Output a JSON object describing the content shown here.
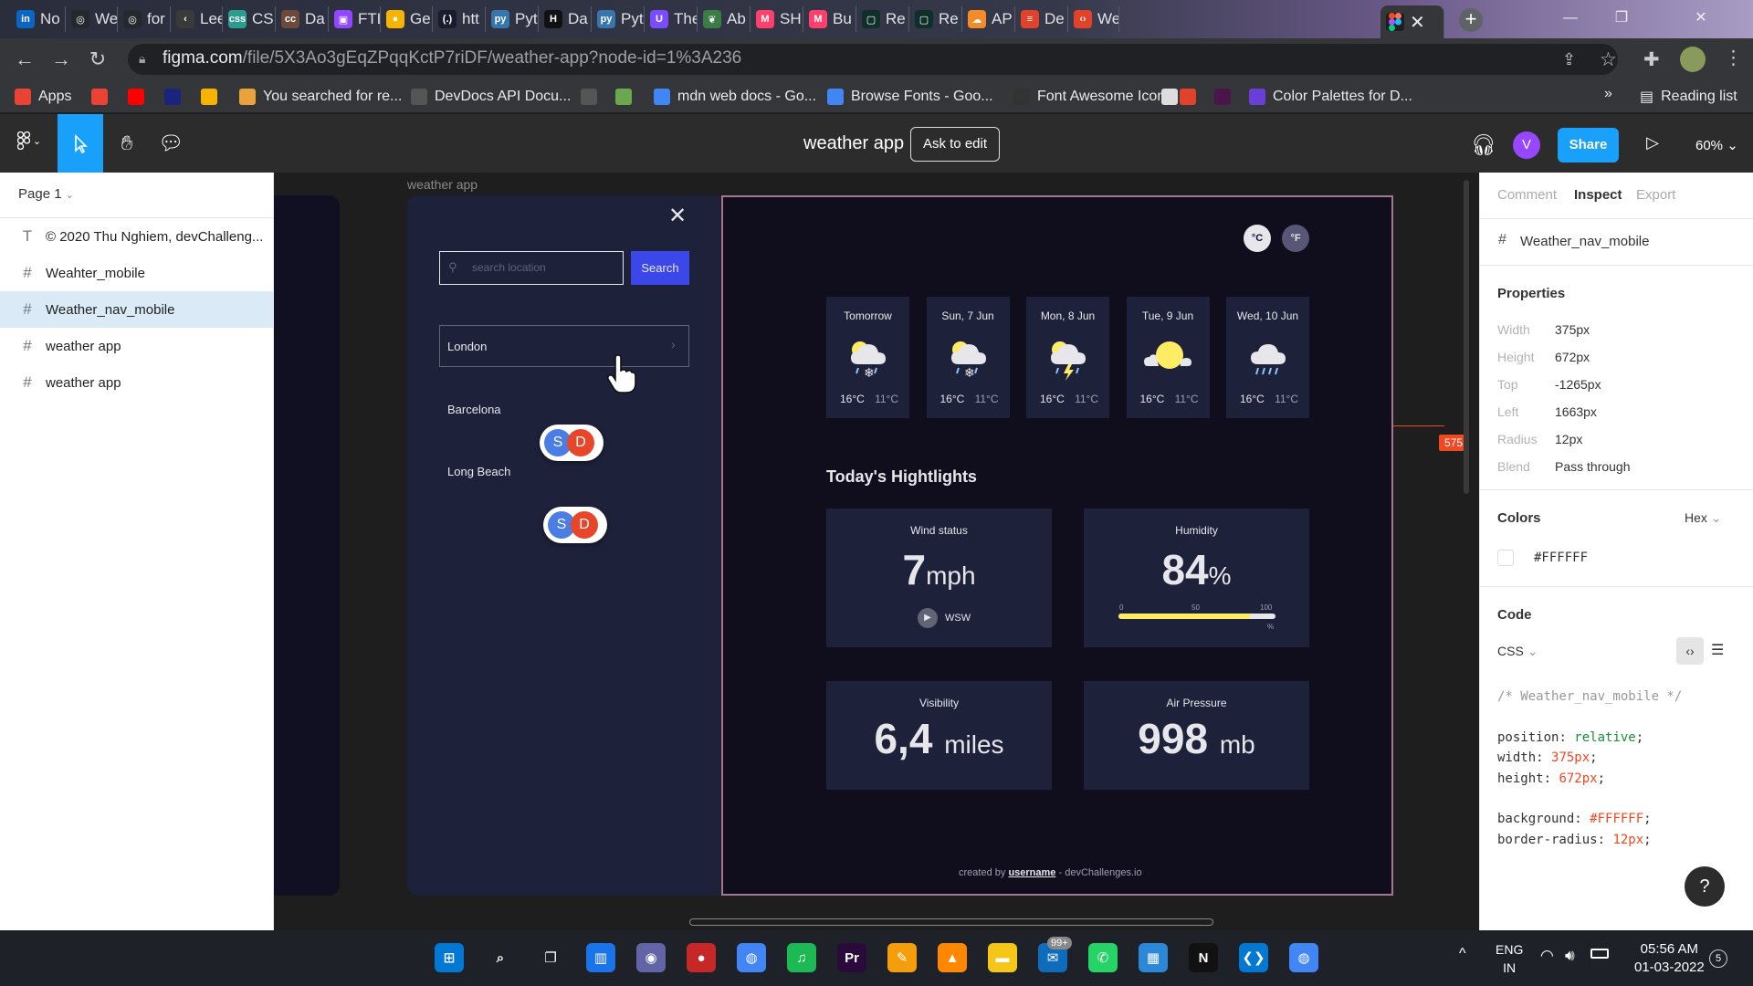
{
  "browser": {
    "tabs": [
      {
        "label": "No",
        "icon": "linkedin-icon",
        "color": "#0a66c2",
        "glyph": "in"
      },
      {
        "label": "We",
        "icon": "github-icon",
        "color": "#24292e",
        "glyph": "◎"
      },
      {
        "label": "for",
        "icon": "github-icon",
        "color": "#24292e",
        "glyph": "◎"
      },
      {
        "label": "Lee",
        "icon": "leetcode-icon",
        "color": "#3a3a3a",
        "glyph": "‹"
      },
      {
        "label": "CS",
        "icon": "css-icon",
        "color": "#2a9d8f",
        "glyph": "css"
      },
      {
        "label": "Da",
        "icon": "codecademy-icon",
        "color": "#6b4a3a",
        "glyph": "cc"
      },
      {
        "label": "FTL",
        "icon": "twitch-icon",
        "color": "#9146ff",
        "glyph": "▣"
      },
      {
        "label": "Ge",
        "icon": "keep-icon",
        "color": "#f6b400",
        "glyph": "●"
      },
      {
        "label": "htt",
        "icon": "regex-icon",
        "color": "#1a1a2e",
        "glyph": "(.)"
      },
      {
        "label": "Pyt",
        "icon": "python-icon",
        "color": "#3776ab",
        "glyph": "py"
      },
      {
        "label": "Da",
        "icon": "hackerrank-icon",
        "color": "#111",
        "glyph": "H"
      },
      {
        "label": "Pyt",
        "icon": "python-icon",
        "color": "#3776ab",
        "glyph": "py"
      },
      {
        "label": "The",
        "icon": "ublock-icon",
        "color": "#7a4cff",
        "glyph": "U"
      },
      {
        "label": "Ab",
        "icon": "leaf-icon",
        "color": "#3a7d44",
        "glyph": "❦"
      },
      {
        "label": "SH",
        "icon": "myntra-icon",
        "color": "#ff3f6c",
        "glyph": "M"
      },
      {
        "label": "Bu",
        "icon": "myntra-icon",
        "color": "#ff3f6c",
        "glyph": "M"
      },
      {
        "label": "Re",
        "icon": "square-icon",
        "color": "#0f2f2a",
        "glyph": "▢"
      },
      {
        "label": "Re",
        "icon": "square-icon",
        "color": "#0f2f2a",
        "glyph": "▢"
      },
      {
        "label": "AP",
        "icon": "cloud-icon",
        "color": "#f28c28",
        "glyph": "☁"
      },
      {
        "label": "De",
        "icon": "devdocs-icon",
        "color": "#e2422a",
        "glyph": "≡"
      },
      {
        "label": "We",
        "icon": "code-icon",
        "color": "#e2422a",
        "glyph": "‹›"
      }
    ],
    "active_tab_icon": "figma-icon",
    "url_host": "figma.com",
    "url_path": "/file/5X3Ao3gEqZPqqKctP7riDF/weather-app?node-id=1%3A236",
    "bookmarks": [
      {
        "label": "Apps",
        "icon": "apps-grid-icon",
        "color": "#ea4335"
      },
      {
        "label": "",
        "icon": "gmail-icon",
        "color": "#ea4335"
      },
      {
        "label": "",
        "icon": "youtube-icon",
        "color": "#ff0000"
      },
      {
        "label": "",
        "icon": "devhints-icon",
        "color": "#1a237e"
      },
      {
        "label": "",
        "icon": "keep-icon",
        "color": "#f6b400"
      },
      {
        "label": "You searched for re...",
        "icon": "sun-icon",
        "color": "#e8a33d"
      },
      {
        "label": "DevDocs API Docu...",
        "icon": "devdocs-icon",
        "color": "#555"
      },
      {
        "label": "",
        "icon": "speed-icon",
        "color": "#555"
      },
      {
        "label": "",
        "icon": "image-icon",
        "color": "#6aa84f"
      },
      {
        "label": "mdn web docs - Go...",
        "icon": "google-icon",
        "color": "#4285f4"
      },
      {
        "label": "Browse Fonts - Goo...",
        "icon": "fonts-icon",
        "color": "#4285f4"
      },
      {
        "label": "Font Awesome Icons",
        "icon": "flag-icon",
        "color": "#333"
      },
      {
        "label": "",
        "icon": "doc-icon",
        "color": "#ddd"
      },
      {
        "label": "",
        "icon": "code-icon",
        "color": "#e2422a"
      },
      {
        "label": "",
        "icon": "slack-icon",
        "color": "#4a154b"
      },
      {
        "label": "Color Palettes for D...",
        "icon": "palette-icon",
        "color": "#6a3fd6"
      }
    ],
    "reading_list": "Reading list",
    "more_bookmarks": "»"
  },
  "figma": {
    "file_title": "weather app",
    "ask_to_edit": "Ask to edit",
    "avatar_initial": "V",
    "share_label": "Share",
    "zoom_label": "60%",
    "page_label": "Page 1",
    "layers": [
      {
        "label": "© 2020 Thu Nghiem, devChalleng...",
        "icon": "text-icon",
        "glyph": "T",
        "selected": false
      },
      {
        "label": "Weahter_mobile",
        "icon": "frame-icon",
        "glyph": "#",
        "selected": false
      },
      {
        "label": "Weather_nav_mobile",
        "icon": "frame-icon",
        "glyph": "#",
        "selected": true
      },
      {
        "label": "weather app",
        "icon": "frame-icon",
        "glyph": "#",
        "selected": false
      },
      {
        "label": "weather app",
        "icon": "frame-icon",
        "glyph": "#",
        "selected": false
      }
    ],
    "canvas_frame_label": "weather app",
    "measure_badge": "575",
    "inspect": {
      "tabs": [
        "Comment",
        "Inspect",
        "Export"
      ],
      "active_tab": "Inspect",
      "selected_name": "Weather_nav_mobile",
      "properties_title": "Properties",
      "properties": [
        {
          "label": "Width",
          "value": "375px"
        },
        {
          "label": "Height",
          "value": "672px"
        },
        {
          "label": "Top",
          "value": "-1265px"
        },
        {
          "label": "Left",
          "value": "1663px"
        },
        {
          "label": "Radius",
          "value": "12px"
        },
        {
          "label": "Blend",
          "value": "Pass through"
        }
      ],
      "colors_title": "Colors",
      "color_format": "Hex",
      "color_value": "#FFFFFF",
      "code_title": "Code",
      "code_lang": "CSS",
      "css_comment": "/* Weather_nav_mobile */",
      "css_lines": [
        {
          "prop": "position",
          "val": "relative",
          "cls": "cg"
        },
        {
          "prop": "width",
          "val": "375px",
          "cls": "co"
        },
        {
          "prop": "height",
          "val": "672px",
          "cls": "co"
        },
        {
          "prop": "background",
          "val": "#FFFFFF",
          "cls": "co"
        },
        {
          "prop": "border-radius",
          "val": "12px",
          "cls": "co"
        }
      ],
      "help": "?"
    }
  },
  "weather_nav": {
    "search_placeholder": "search location",
    "search_button": "Search",
    "cities": [
      "London",
      "Barcelona",
      "Long Beach"
    ],
    "collab_initials": [
      "S",
      "D"
    ]
  },
  "weather_main": {
    "celsius": "°C",
    "fahrenheit": "°F",
    "forecast": [
      {
        "day": "Tomorrow",
        "icon": "sleet-icon",
        "max": "16°C",
        "min": "11°C"
      },
      {
        "day": "Sun, 7 Jun",
        "icon": "sleet-icon",
        "max": "16°C",
        "min": "11°C"
      },
      {
        "day": "Mon, 8 Jun",
        "icon": "thunderstorm-icon",
        "max": "16°C",
        "min": "11°C"
      },
      {
        "day": "Tue, 9 Jun",
        "icon": "sun-cloud-icon",
        "max": "16°C",
        "min": "11°C"
      },
      {
        "day": "Wed, 10 Jun",
        "icon": "rain-icon",
        "max": "16°C",
        "min": "11°C"
      }
    ],
    "highlights_title": "Today's Hightlights",
    "wind": {
      "title": "Wind status",
      "value": "7",
      "unit": "mph",
      "direction": "WSW"
    },
    "humidity": {
      "title": "Humidity",
      "value": "84",
      "unit": "%",
      "percent": 84,
      "ticks": [
        "0",
        "50",
        "100"
      ],
      "tick_unit": "%"
    },
    "visibility": {
      "title": "Visibility",
      "value": "6,4",
      "unit": "miles"
    },
    "pressure": {
      "title": "Air Pressure",
      "value": "998",
      "unit": "mb"
    },
    "footer_prefix": "created by",
    "footer_user": "username",
    "footer_suffix": "- devChallenges.io"
  },
  "taskbar": {
    "apps": [
      {
        "icon": "windows-start-icon",
        "color": "#0078d4",
        "glyph": "⊞"
      },
      {
        "icon": "search-icon",
        "color": "transparent",
        "glyph": "⌕"
      },
      {
        "icon": "task-view-icon",
        "color": "transparent",
        "glyph": "❐"
      },
      {
        "icon": "widgets-icon",
        "color": "#1a73e8",
        "glyph": "▥"
      },
      {
        "icon": "teams-chat-icon",
        "color": "#6264a7",
        "glyph": "◉"
      },
      {
        "icon": "record-icon",
        "color": "#c62828",
        "glyph": "●"
      },
      {
        "icon": "chrome-icon",
        "color": "#4285f4",
        "glyph": "◍"
      },
      {
        "icon": "spotify-icon",
        "color": "#1db954",
        "glyph": "♫"
      },
      {
        "icon": "premiere-icon",
        "color": "#2a0a3a",
        "glyph": "Pr"
      },
      {
        "icon": "paint-icon",
        "color": "#f59e0b",
        "glyph": "✎"
      },
      {
        "icon": "vlc-icon",
        "color": "#ff8800",
        "glyph": "▲"
      },
      {
        "icon": "file-explorer-icon",
        "color": "#f5c518",
        "glyph": "▬"
      },
      {
        "icon": "mail-icon",
        "color": "#0f6cbd",
        "glyph": "✉"
      },
      {
        "icon": "whatsapp-icon",
        "color": "#25d366",
        "glyph": "✆"
      },
      {
        "icon": "photos-icon",
        "color": "#2b88d8",
        "glyph": "▦"
      },
      {
        "icon": "netflix-icon",
        "color": "#111",
        "glyph": "N"
      },
      {
        "icon": "vscode-icon",
        "color": "#0078d4",
        "glyph": "❮❯"
      },
      {
        "icon": "chrome-icon",
        "color": "#4285f4",
        "glyph": "◍"
      }
    ],
    "mail_badge": "99+",
    "lang_line1": "ENG",
    "lang_line2": "IN",
    "time": "05:56 AM",
    "date": "01-03-2022",
    "notification_count": "5"
  }
}
